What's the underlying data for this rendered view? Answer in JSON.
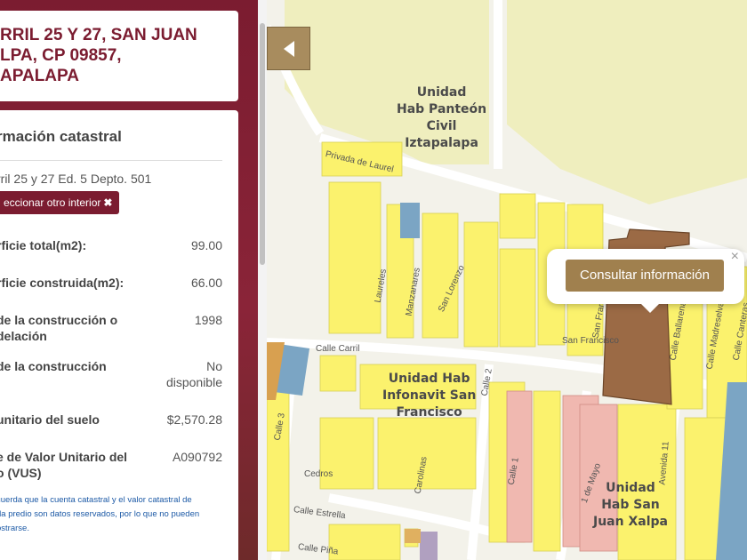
{
  "address": {
    "line1": "RRIL 25 Y 27, SAN JUAN",
    "line2": "LPA, CP 09857,",
    "line3": "APALAPA"
  },
  "info": {
    "title": "rmación catastral",
    "unit": "rril 25 y 27 Ed. 5 Depto. 501",
    "reselect_label": "eccionar otro interior",
    "reselect_icon": "close-x-icon",
    "rows": [
      {
        "label": "rficie total(m2):",
        "value": "99.00"
      },
      {
        "label": "rficie construida(m2):",
        "value": "66.00"
      },
      {
        "label1": "de la construcción o",
        "label2": "delación",
        "value": "1998"
      },
      {
        "label1": "de la construcción",
        "value1": "No",
        "value2": "disponible"
      },
      {
        "label": "unitario del suelo",
        "value": "$2,570.28"
      },
      {
        "label1": "e de Valor Unitario del",
        "label2": "o (VUS)",
        "value": "A090792"
      }
    ],
    "note1": "cuerda que la cuenta catastral y el valor catastral de",
    "note2": "da predio son datos reservados, por lo que no pueden",
    "note3": "ostrarse."
  },
  "map": {
    "labels": {
      "panteon1": "Unidad",
      "panteon2": "Hab Panteón",
      "panteon3": "Civil",
      "panteon4": "Iztapalapa",
      "infonavit1": "Unidad Hab",
      "infonavit2": "Infonavit San",
      "infonavit3": "Francisco",
      "xalpa1": "Unidad",
      "xalpa2": "Hab San",
      "xalpa3": "Juan Xalpa"
    },
    "streets": {
      "privada": "Privada de Laurel",
      "laureles": "Laureles",
      "manzanares": "Manzanares",
      "sanlorenzo": "San Lorenzo",
      "carril": "Calle Carril",
      "calle3": "Calle 3",
      "calle2": "Calle 2",
      "calle1": "Calle 1",
      "cedros": "Cedros",
      "carolinas": "Carolinas",
      "estrella": "Calle Estrella",
      "pina": "Calle Piña",
      "sanfrancisco": "San Francisco",
      "sanfrancisco2": "San Francisc",
      "mayo": "1 de Mayo",
      "avenida11": "Avenida 11",
      "ballarenas": "Calle Ballarenas",
      "madreselvas": "Calle Madreselvas",
      "canteras": "Calle Canteras"
    },
    "colors": {
      "block": "#fbf26d",
      "green_area": "#efeebe",
      "selected": "#9b6a45",
      "water": "#7ba5c4",
      "pink": "#f0b8b0"
    },
    "collapse_icon": "chevron-left-icon"
  },
  "popup": {
    "button_label": "Consultar información",
    "close_label": "×"
  }
}
